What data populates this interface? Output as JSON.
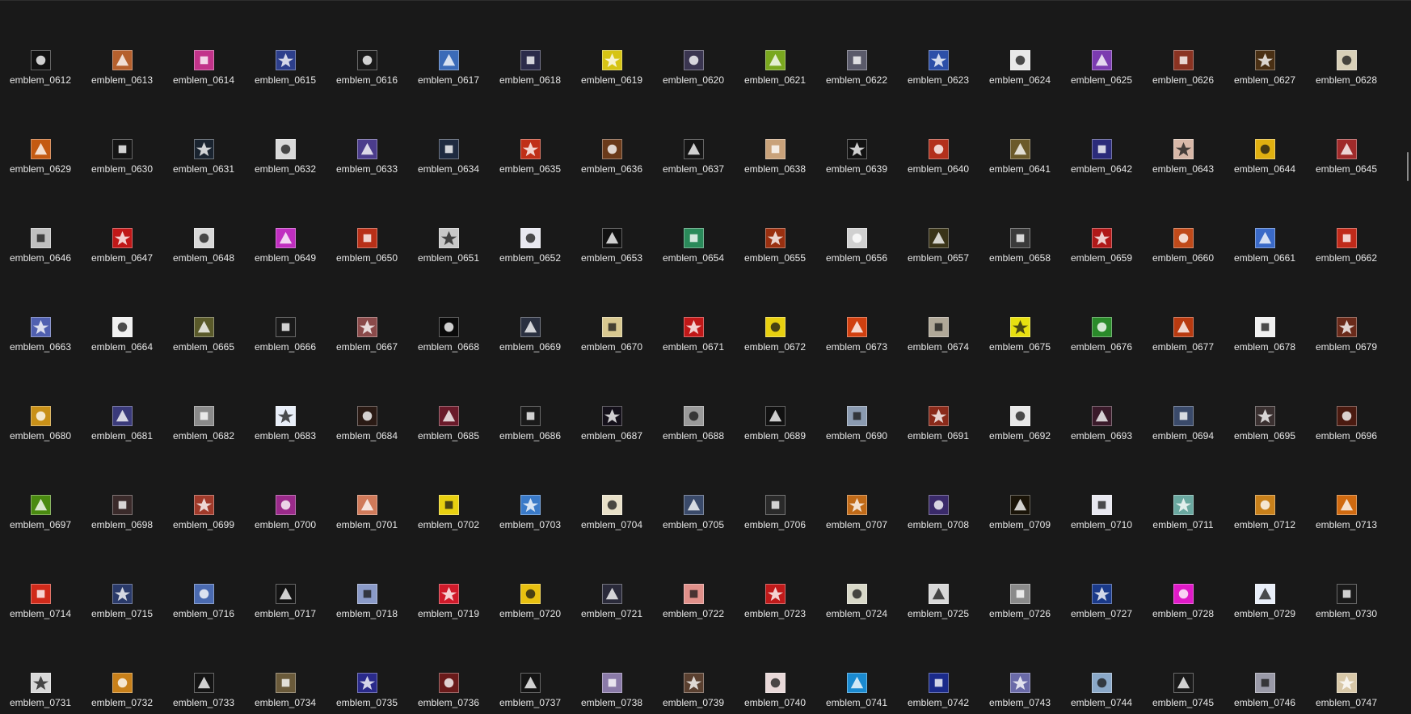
{
  "grid": {
    "columns": 17,
    "items": [
      {
        "label": "emblem_0612",
        "icon": "black-mountain-emblem",
        "color": "#111111"
      },
      {
        "label": "emblem_0613",
        "icon": "orange-beast-emblem",
        "color": "#b5602d"
      },
      {
        "label": "emblem_0614",
        "icon": "pink-flower-emblem",
        "color": "#c2338a"
      },
      {
        "label": "emblem_0615",
        "icon": "blue-knight-emblem",
        "color": "#2d3f8c"
      },
      {
        "label": "emblem_0616",
        "icon": "skull-crossbones-emblem",
        "color": "#1a1a1a"
      },
      {
        "label": "emblem_0617",
        "icon": "blue-slash-emblem",
        "color": "#3b6bb8"
      },
      {
        "label": "emblem_0618",
        "icon": "gear-warrior-emblem",
        "color": "#2b2b4a"
      },
      {
        "label": "emblem_0619",
        "icon": "yellow-radiation-emblem",
        "color": "#d6c415"
      },
      {
        "label": "emblem_0620",
        "icon": "dark-dragon-emblem",
        "color": "#3a3550"
      },
      {
        "label": "emblem_0621",
        "icon": "green-orb-emblem",
        "color": "#7aa81f"
      },
      {
        "label": "emblem_0622",
        "icon": "silver-shield-emblem",
        "color": "#5a5a6a"
      },
      {
        "label": "emblem_0623",
        "icon": "blue-skull-emblem",
        "color": "#2c4fa8"
      },
      {
        "label": "emblem_0624",
        "icon": "yin-yang-emblem",
        "color": "#e8e8e8"
      },
      {
        "label": "emblem_0625",
        "icon": "purple-cross-emblem",
        "color": "#7b3bb0"
      },
      {
        "label": "emblem_0626",
        "icon": "red-demon-emblem",
        "color": "#8a3322"
      },
      {
        "label": "emblem_0627",
        "icon": "golden-bat-emblem",
        "color": "#4a3014"
      },
      {
        "label": "emblem_0628",
        "icon": "white-totem-emblem",
        "color": "#d8d0b8"
      },
      {
        "label": "emblem_0629",
        "icon": "fire-orb-emblem",
        "color": "#c45a12"
      },
      {
        "label": "emblem_0630",
        "icon": "white-cross-emblem",
        "color": "#141414"
      },
      {
        "label": "emblem_0631",
        "icon": "white-ring-emblem",
        "color": "#1a2430"
      },
      {
        "label": "emblem_0632",
        "icon": "white-angel-emblem",
        "color": "#d9d9d9"
      },
      {
        "label": "emblem_0633",
        "icon": "purple-figure-emblem",
        "color": "#4b3c8c"
      },
      {
        "label": "emblem_0634",
        "icon": "moon-night-emblem",
        "color": "#1e2a40"
      },
      {
        "label": "emblem_0635",
        "icon": "red-star-emblem",
        "color": "#c03018"
      },
      {
        "label": "emblem_0636",
        "icon": "orange-warrior-emblem",
        "color": "#6a3a1a"
      },
      {
        "label": "emblem_0637",
        "icon": "pentagram-emblem",
        "color": "#151515"
      },
      {
        "label": "emblem_0638",
        "icon": "kanji-seal-emblem",
        "color": "#c9a27a"
      },
      {
        "label": "emblem_0639",
        "icon": "white-star-burst-emblem",
        "color": "#121212"
      },
      {
        "label": "emblem_0640",
        "icon": "red-flame-emblem",
        "color": "#b3301c"
      },
      {
        "label": "emblem_0641",
        "icon": "golden-knot-emblem",
        "color": "#6b5a2a"
      },
      {
        "label": "emblem_0642",
        "icon": "blue-spirit-emblem",
        "color": "#2b2b7a"
      },
      {
        "label": "emblem_0643",
        "icon": "anime-face-emblem",
        "color": "#d8b8a8"
      },
      {
        "label": "emblem_0644",
        "icon": "paw-print-emblem",
        "color": "#e0b010"
      },
      {
        "label": "emblem_0645",
        "icon": "red-white-emblem",
        "color": "#a02a2a"
      },
      {
        "label": "emblem_0646",
        "icon": "crossed-box-emblem",
        "color": "#bfbfbf"
      },
      {
        "label": "emblem_0647",
        "icon": "red-fist-emblem",
        "color": "#c01818"
      },
      {
        "label": "emblem_0648",
        "icon": "templar-shield-emblem",
        "color": "#d8d8d8"
      },
      {
        "label": "emblem_0649",
        "icon": "pink-diagonal-emblem",
        "color": "#c02ec0"
      },
      {
        "label": "emblem_0650",
        "icon": "red-anime-emblem",
        "color": "#b83018"
      },
      {
        "label": "emblem_0651",
        "icon": "iron-cross-emblem",
        "color": "#c8c8c8"
      },
      {
        "label": "emblem_0652",
        "icon": "blue-pixel-emblem",
        "color": "#e8e8f0"
      },
      {
        "label": "emblem_0653",
        "icon": "kanji-weight-emblem",
        "color": "#111111"
      },
      {
        "label": "emblem_0654",
        "icon": "green-heart-emblem",
        "color": "#2a8a5a"
      },
      {
        "label": "emblem_0655",
        "icon": "green-eye-emblem",
        "color": "#9a3010"
      },
      {
        "label": "emblem_0656",
        "icon": "dark-shield-emblem",
        "color": "#d0d0d0"
      },
      {
        "label": "emblem_0657",
        "icon": "gold-creature-emblem",
        "color": "#3a3418"
      },
      {
        "label": "emblem_0658",
        "icon": "grey-skull-emblem",
        "color": "#3a3a3a"
      },
      {
        "label": "emblem_0659",
        "icon": "red-dragon-emblem",
        "color": "#b01818"
      },
      {
        "label": "emblem_0660",
        "icon": "orange-fighter-emblem",
        "color": "#c04a1a"
      },
      {
        "label": "emblem_0661",
        "icon": "blue-sky-emblem",
        "color": "#3a6ac8"
      },
      {
        "label": "emblem_0662",
        "icon": "red-gold-eye-emblem",
        "color": "#c02a1a"
      },
      {
        "label": "emblem_0663",
        "icon": "blue-shield-emblem",
        "color": "#5060b0"
      },
      {
        "label": "emblem_0664",
        "icon": "black-white-split-emblem",
        "color": "#f0f0f0"
      },
      {
        "label": "emblem_0665",
        "icon": "gothic-a-emblem",
        "color": "#5a5a2a"
      },
      {
        "label": "emblem_0666",
        "icon": "white-skull-emblem",
        "color": "#1a1a1a"
      },
      {
        "label": "emblem_0667",
        "icon": "pink-character-emblem",
        "color": "#8a4a4a"
      },
      {
        "label": "emblem_0668",
        "icon": "swoosh-emblem",
        "color": "#0a0a0a"
      },
      {
        "label": "emblem_0669",
        "icon": "hooded-figure-emblem",
        "color": "#2a3040"
      },
      {
        "label": "emblem_0670",
        "icon": "golden-cross-emblem",
        "color": "#d8c890"
      },
      {
        "label": "emblem_0671",
        "icon": "red-devil-emblem",
        "color": "#c01818"
      },
      {
        "label": "emblem_0672",
        "icon": "red-yellow-emblem",
        "color": "#e8d010"
      },
      {
        "label": "emblem_0673",
        "icon": "red-f-emblem",
        "color": "#d04010"
      },
      {
        "label": "emblem_0674",
        "icon": "silver-coin-emblem",
        "color": "#b0a898"
      },
      {
        "label": "emblem_0675",
        "icon": "yellow-sword-emblem",
        "color": "#e8e010"
      },
      {
        "label": "emblem_0676",
        "icon": "green-clover-emblem",
        "color": "#2a8a2a"
      },
      {
        "label": "emblem_0677",
        "icon": "fire-demon-emblem",
        "color": "#b83a10"
      },
      {
        "label": "emblem_0678",
        "icon": "cannabis-leaf-emblem",
        "color": "#f0f0f0"
      },
      {
        "label": "emblem_0679",
        "icon": "red-brown-emblem",
        "color": "#6a2a1a"
      },
      {
        "label": "emblem_0680",
        "icon": "golden-cross-shield-emblem",
        "color": "#c89018"
      },
      {
        "label": "emblem_0681",
        "icon": "blue-lightning-emblem",
        "color": "#3a3a7a"
      },
      {
        "label": "emblem_0682",
        "icon": "grey-portrait-emblem",
        "color": "#8a8a8a"
      },
      {
        "label": "emblem_0683",
        "icon": "white-blue-emblem",
        "color": "#e8eef8"
      },
      {
        "label": "emblem_0684",
        "icon": "dark-rune-emblem",
        "color": "#2a1a14"
      },
      {
        "label": "emblem_0685",
        "icon": "red-ball-emblem",
        "color": "#6a1a2a"
      },
      {
        "label": "emblem_0686",
        "icon": "dark-warrior-emblem",
        "color": "#1a1a1a"
      },
      {
        "label": "emblem_0687",
        "icon": "dark-figure-emblem",
        "color": "#14101a"
      },
      {
        "label": "emblem_0688",
        "icon": "grey-round-emblem",
        "color": "#9a9a9a"
      },
      {
        "label": "emblem_0689",
        "icon": "bunny-emblem",
        "color": "#111111"
      },
      {
        "label": "emblem_0690",
        "icon": "silver-blade-emblem",
        "color": "#8a9ab0"
      },
      {
        "label": "emblem_0691",
        "icon": "red-character-emblem",
        "color": "#8a2a1a"
      },
      {
        "label": "emblem_0692",
        "icon": "white-gate-emblem",
        "color": "#e8e8e8"
      },
      {
        "label": "emblem_0693",
        "icon": "red-star-dark-emblem",
        "color": "#3a1a2a"
      },
      {
        "label": "emblem_0694",
        "icon": "blue-grid-emblem",
        "color": "#3a4a6a"
      },
      {
        "label": "emblem_0695",
        "icon": "dark-knight-emblem",
        "color": "#3a3030"
      },
      {
        "label": "emblem_0696",
        "icon": "dark-red-emblem",
        "color": "#4a1a10"
      },
      {
        "label": "emblem_0697",
        "icon": "green-ring-emblem",
        "color": "#4a8a10"
      },
      {
        "label": "emblem_0698",
        "icon": "skeleton-emblem",
        "color": "#3a2a2a"
      },
      {
        "label": "emblem_0699",
        "icon": "red-green-emblem",
        "color": "#a03a2a"
      },
      {
        "label": "emblem_0700",
        "icon": "purple-frame-emblem",
        "color": "#9a2a8a"
      },
      {
        "label": "emblem_0701",
        "icon": "orange-pink-emblem",
        "color": "#d07a5a"
      },
      {
        "label": "emblem_0702",
        "icon": "radiation-symbol-emblem",
        "color": "#e8d010"
      },
      {
        "label": "emblem_0703",
        "icon": "blue-red-character-emblem",
        "color": "#3a7ac8"
      },
      {
        "label": "emblem_0704",
        "icon": "letter-f-emblem",
        "color": "#e8e0c8"
      },
      {
        "label": "emblem_0705",
        "icon": "blue-warrior-emblem",
        "color": "#3a4a6a"
      },
      {
        "label": "emblem_0706",
        "icon": "green-x-emblem",
        "color": "#2a2a2a"
      },
      {
        "label": "emblem_0707",
        "icon": "orange-beast-emblem-2",
        "color": "#c06a18"
      },
      {
        "label": "emblem_0708",
        "icon": "purple-demon-emblem",
        "color": "#3a2a6a"
      },
      {
        "label": "emblem_0709",
        "icon": "golden-ring-emblem",
        "color": "#1a1408"
      },
      {
        "label": "emblem_0710",
        "icon": "blue-gold-emblem",
        "color": "#e8e8f0"
      },
      {
        "label": "emblem_0711",
        "icon": "teal-character-emblem",
        "color": "#6aa8a0"
      },
      {
        "label": "emblem_0712",
        "icon": "lion-emblem",
        "color": "#c8801a"
      },
      {
        "label": "emblem_0713",
        "icon": "orange-eye-emblem",
        "color": "#d06a10"
      },
      {
        "label": "emblem_0714",
        "icon": "red-circle-emblem",
        "color": "#d02a1a"
      },
      {
        "label": "emblem_0715",
        "icon": "blue-wolf-emblem",
        "color": "#2a3a6a"
      },
      {
        "label": "emblem_0716",
        "icon": "blue-swirl-emblem",
        "color": "#4a6ab0"
      },
      {
        "label": "emblem_0717",
        "icon": "white-dragon-emblem",
        "color": "#141414"
      },
      {
        "label": "emblem_0718",
        "icon": "blue-angel-emblem",
        "color": "#8a9ac8"
      },
      {
        "label": "emblem_0719",
        "icon": "red-wave-emblem",
        "color": "#d01a2a"
      },
      {
        "label": "emblem_0720",
        "icon": "yellow-dragon-emblem",
        "color": "#e8c010"
      },
      {
        "label": "emblem_0721",
        "icon": "dark-reaper-emblem",
        "color": "#2a2a3a"
      },
      {
        "label": "emblem_0722",
        "icon": "pink-pig-emblem",
        "color": "#e0908a"
      },
      {
        "label": "emblem_0723",
        "icon": "white-eagle-emblem",
        "color": "#c01a1a"
      },
      {
        "label": "emblem_0724",
        "icon": "ink-figure-emblem",
        "color": "#d8d8c8"
      },
      {
        "label": "emblem_0725",
        "icon": "grey-frame-emblem",
        "color": "#d8d8d8"
      },
      {
        "label": "emblem_0726",
        "icon": "leaf-village-emblem",
        "color": "#8a8a8a"
      },
      {
        "label": "emblem_0727",
        "icon": "blue-caduceus-emblem",
        "color": "#1a3a8a"
      },
      {
        "label": "emblem_0728",
        "icon": "magenta-eye-emblem",
        "color": "#e01ac8"
      },
      {
        "label": "emblem_0729",
        "icon": "blue-kanji-emblem",
        "color": "#e8eef8"
      },
      {
        "label": "emblem_0730",
        "icon": "silver-skull-shield-emblem",
        "color": "#1a1a1a"
      },
      {
        "label": "emblem_0731",
        "icon": "running-figure-emblem",
        "color": "#d8d8d8"
      },
      {
        "label": "emblem_0732",
        "icon": "orange-swirl-emblem",
        "color": "#c8801a"
      },
      {
        "label": "emblem_0733",
        "icon": "imperial-emblem",
        "color": "#141414"
      },
      {
        "label": "emblem_0734",
        "icon": "brown-dragon-emblem",
        "color": "#6a5a3a"
      },
      {
        "label": "emblem_0735",
        "icon": "blue-character-emblem",
        "color": "#2a2a8a"
      },
      {
        "label": "emblem_0736",
        "icon": "red-skull-emblem",
        "color": "#6a1a1a"
      },
      {
        "label": "emblem_0737",
        "icon": "letter-h-emblem",
        "color": "#141414"
      },
      {
        "label": "emblem_0738",
        "icon": "pink-blue-emblem",
        "color": "#8a7aa8"
      },
      {
        "label": "emblem_0739",
        "icon": "brown-face-emblem",
        "color": "#5a4030"
      },
      {
        "label": "emblem_0740",
        "icon": "red-shield-emblem",
        "color": "#e8d8d8"
      },
      {
        "label": "emblem_0741",
        "icon": "snowflake-emblem",
        "color": "#1a8ad0"
      },
      {
        "label": "emblem_0742",
        "icon": "alien-emblem",
        "color": "#1a2a8a"
      },
      {
        "label": "emblem_0743",
        "icon": "purple-maiden-emblem",
        "color": "#6a6aa8"
      },
      {
        "label": "emblem_0744",
        "icon": "blue-blade-emblem",
        "color": "#8aa8c8"
      },
      {
        "label": "emblem_0745",
        "icon": "sword-emblem",
        "color": "#1a1a1a"
      },
      {
        "label": "emblem_0746",
        "icon": "silver-pink-emblem",
        "color": "#9a9aa8"
      },
      {
        "label": "emblem_0747",
        "icon": "sunglasses-face-emblem",
        "color": "#d8c8a8"
      }
    ]
  }
}
